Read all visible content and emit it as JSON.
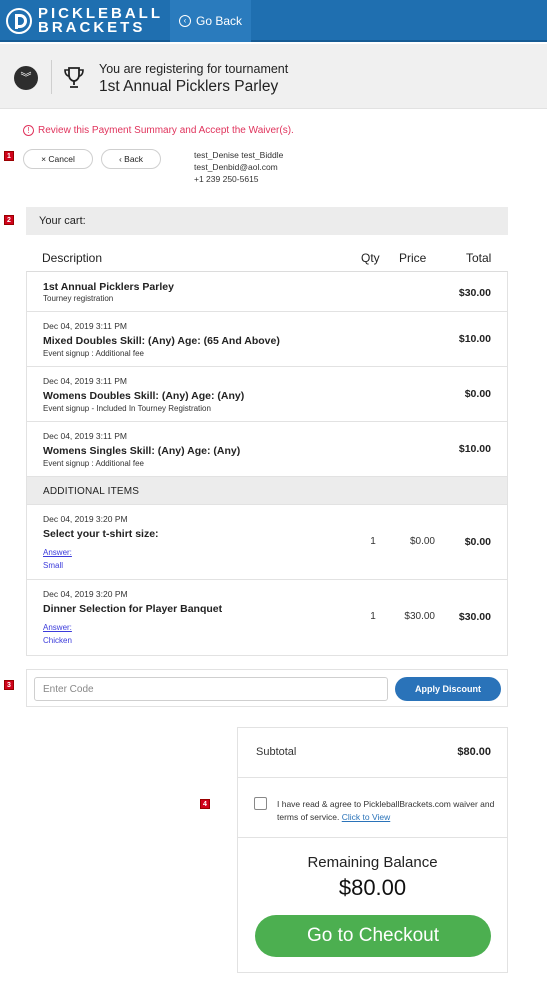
{
  "header": {
    "logo_line1": "PICKLEBALL",
    "logo_line2": "BRACKETS",
    "go_back_label": "Go Back"
  },
  "tournament": {
    "registering_text": "You are registering for tournament",
    "name": "1st Annual Picklers Parley"
  },
  "review_notice": "Review this Payment Summary and Accept the Waiver(s).",
  "markers": [
    "1",
    "2",
    "3",
    "4"
  ],
  "actions": {
    "cancel_label": "× Cancel",
    "back_label": "‹ Back"
  },
  "user": {
    "name": "test_Denise test_Biddle",
    "email": "test_Denbid@aol.com",
    "phone": "+1 239 250-5615"
  },
  "cart": {
    "heading": "Your cart:",
    "columns": {
      "description": "Description",
      "qty": "Qty",
      "price": "Price",
      "total": "Total"
    },
    "items": [
      {
        "date": "",
        "title": "1st Annual Picklers Parley",
        "sub": "Tourney registration",
        "qty": "",
        "price": "",
        "total": "$30.00"
      },
      {
        "date": "Dec 04, 2019 3:11 PM",
        "title": "Mixed Doubles Skill: (Any) Age: (65 And Above)",
        "sub": "Event signup : Additional fee",
        "qty": "",
        "price": "",
        "total": "$10.00"
      },
      {
        "date": "Dec 04, 2019 3:11 PM",
        "title": "Womens Doubles Skill: (Any) Age: (Any)",
        "sub": "Event signup - Included In Tourney Registration",
        "qty": "",
        "price": "",
        "total": "$0.00"
      },
      {
        "date": "Dec 04, 2019 3:11 PM",
        "title": "Womens Singles Skill: (Any) Age: (Any)",
        "sub": "Event signup : Additional fee",
        "qty": "",
        "price": "",
        "total": "$10.00"
      }
    ],
    "additional_heading": "ADDITIONAL ITEMS",
    "additional_items": [
      {
        "date": "Dec 04, 2019 3:20 PM",
        "title": "Select your t-shirt size:",
        "answer_label": "Answer:",
        "answer": "Small",
        "qty": "1",
        "price": "$0.00",
        "total": "$0.00"
      },
      {
        "date": "Dec 04, 2019 3:20 PM",
        "title": "Dinner Selection for Player Banquet",
        "answer_label": "Answer:",
        "answer": "Chicken",
        "qty": "1",
        "price": "$30.00",
        "total": "$30.00"
      }
    ]
  },
  "discount": {
    "placeholder": "Enter Code",
    "button_label": "Apply Discount"
  },
  "summary": {
    "subtotal_label": "Subtotal",
    "subtotal_value": "$80.00",
    "waiver_text": "I have read & agree to PickleballBrackets.com waiver and terms of service.",
    "waiver_link": "Click to View",
    "remaining_label": "Remaining Balance",
    "remaining_value": "$80.00",
    "checkout_label": "Go to Checkout"
  },
  "colors": {
    "brand_blue": "#1f6fb0",
    "alert_pink": "#e0335c",
    "checkout_green": "#4caf50",
    "link_blue": "#2a73b9"
  }
}
